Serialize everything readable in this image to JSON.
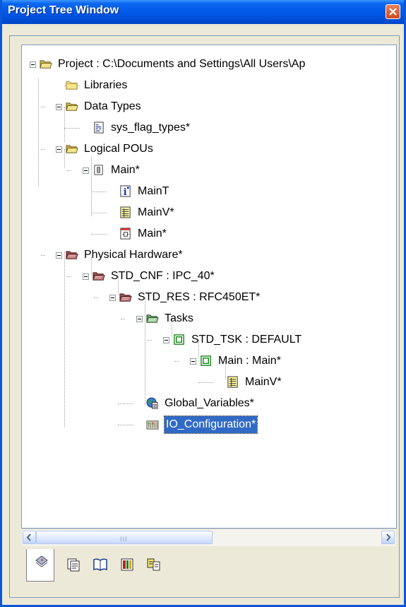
{
  "window": {
    "title": "Project Tree Window"
  },
  "tree": [
    {
      "id": "project",
      "label": "Project : C:\\Documents and Settings\\All Users\\Ap",
      "icon": "folder-open-icon"
    },
    {
      "id": "libraries",
      "label": "Libraries",
      "icon": "folder-icon"
    },
    {
      "id": "data-types",
      "label": "Data Types",
      "icon": "folder-open-icon"
    },
    {
      "id": "sys-flag-types",
      "label": "sys_flag_types*",
      "icon": "datatype-file-icon"
    },
    {
      "id": "logical-pous",
      "label": "Logical POUs",
      "icon": "folder-open-icon"
    },
    {
      "id": "main-pou",
      "label": "Main*",
      "icon": "pou-icon"
    },
    {
      "id": "main-t",
      "label": "MainT",
      "icon": "info-icon"
    },
    {
      "id": "main-v",
      "label": "MainV*",
      "icon": "variables-icon"
    },
    {
      "id": "main-code",
      "label": "Main*",
      "icon": "code-sheet-icon"
    },
    {
      "id": "physical-hardware",
      "label": "Physical Hardware*",
      "icon": "hardware-folder-icon"
    },
    {
      "id": "std-cnf",
      "label": "STD_CNF : IPC_40*",
      "icon": "hardware-folder-icon"
    },
    {
      "id": "std-res",
      "label": "STD_RES : RFC450ET*",
      "icon": "hardware-folder-icon"
    },
    {
      "id": "tasks",
      "label": "Tasks",
      "icon": "tasks-folder-icon"
    },
    {
      "id": "std-tsk",
      "label": "STD_TSK : DEFAULT",
      "icon": "task-icon"
    },
    {
      "id": "main-main",
      "label": "Main : Main*",
      "icon": "task-icon"
    },
    {
      "id": "main-v-2",
      "label": "MainV*",
      "icon": "variables-icon"
    },
    {
      "id": "global-variables",
      "label": "Global_Variables*",
      "icon": "globe-icon"
    },
    {
      "id": "io-configuration",
      "label": "IO_Configuration*",
      "icon": "io-config-icon",
      "selected": true
    }
  ],
  "scrollbar": {
    "grip": "III"
  },
  "tabs": [
    {
      "id": "project-tree",
      "icon": "project-tree-tab-icon",
      "active": true
    },
    {
      "id": "libraries",
      "icon": "libraries-tab-icon"
    },
    {
      "id": "book",
      "icon": "book-tab-icon"
    },
    {
      "id": "hardware",
      "icon": "hardware-tab-icon"
    },
    {
      "id": "io",
      "icon": "io-tab-icon"
    }
  ],
  "colors": {
    "titlebar": "#0055e5",
    "selection": "#316ac5",
    "close": "#d04a1c"
  }
}
